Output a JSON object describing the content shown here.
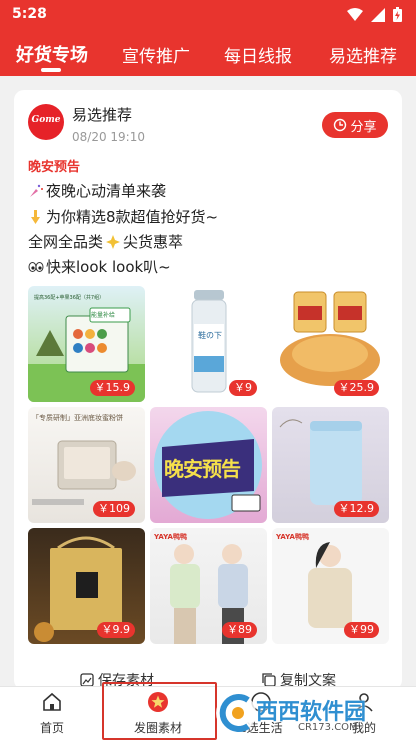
{
  "status": {
    "time": "5:28"
  },
  "tabs": [
    {
      "label": "好货专场",
      "active": true
    },
    {
      "label": "宣传推广"
    },
    {
      "label": "每日线报"
    },
    {
      "label": "易选推荐"
    }
  ],
  "post": {
    "avatar_text": "Gome",
    "author": "易选推荐",
    "datetime": "08/20 19:10",
    "share_label": "分享",
    "headline": "晚安预告",
    "lines": [
      "夜晚心动清单来袭",
      "为你精选8款超值抢好货~",
      "全网全品类",
      "尖货惠萃",
      "快来look look叭~"
    ],
    "products": [
      {
        "price": "￥15.9",
        "tag": "能量补给",
        "subtitle": "提高36配+苹果36配（共7组）"
      },
      {
        "price": "￥9",
        "tag": "鞋の下"
      },
      {
        "price": "￥25.9"
      },
      {
        "price": "￥109",
        "tag": "「专质研制」亚洲底妆蜜粉饼"
      },
      {
        "price": "",
        "tag": "晚安预告"
      },
      {
        "price": "￥12.9"
      },
      {
        "price": "￥9.9"
      },
      {
        "price": "￥89",
        "tag": "YAYA鸭鸭"
      },
      {
        "price": "￥99",
        "tag": "YAYA鸭鸭"
      }
    ],
    "actions": {
      "save": "保存素材",
      "copy": "复制文案"
    }
  },
  "nav": [
    {
      "label": "首页"
    },
    {
      "label": "发圈素材",
      "active": true
    },
    {
      "label": "e选生活"
    },
    {
      "label": "我的"
    }
  ],
  "watermark": {
    "text": "西西软件园",
    "url": "CR173.COM"
  },
  "colors": {
    "brand": "#e8342e",
    "white": "#ffffff"
  }
}
